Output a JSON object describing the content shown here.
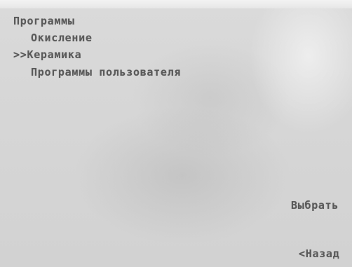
{
  "screen": {
    "title": "Программы",
    "menu": {
      "items": [
        {
          "label": "Окисление",
          "selected": false
        },
        {
          "label": "Керамика",
          "selected": true,
          "cursor": ">>"
        },
        {
          "label": "Программы пользователя",
          "selected": false
        }
      ]
    },
    "softkeys": {
      "select_label": "Выбрать",
      "back_label": "<Назад"
    }
  },
  "colors": {
    "text": "#5a5a5a",
    "background": "#d6d6d6"
  }
}
